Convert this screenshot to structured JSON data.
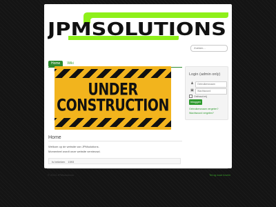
{
  "logo": {
    "text": "JPMSOLUTIONS",
    "accent": "#8ef01a"
  },
  "search": {
    "placeholder": "Zoeken..."
  },
  "nav": {
    "items": [
      {
        "label": "Home",
        "active": true
      },
      {
        "label": "Wiki",
        "active": false
      }
    ]
  },
  "banner": {
    "line1": "UNDER",
    "line2": "CONSTRUCTION"
  },
  "article": {
    "title": "Home",
    "p1": "Welkom op de website van JPMsolutions.",
    "p2": "Momenteel wordt onze website vernieuwd.",
    "hits_label": "Is bekeken",
    "hits_value": "1593"
  },
  "login": {
    "title": "Login (admin only)",
    "username_placeholder": "Gebruikersnaam",
    "password_placeholder": "Wachtwoord",
    "remember": "Onthoud mij",
    "button": "Inloggen",
    "forgot_user": "Gebruikersnaam vergeten?",
    "forgot_pass": "Wachtwoord vergeten?"
  },
  "footer": {
    "copyright": "© 2024 JPMsolutions",
    "back_to_top": "Terug naar boven"
  },
  "colors": {
    "green": "#2e8b2e",
    "background": "#141414"
  }
}
